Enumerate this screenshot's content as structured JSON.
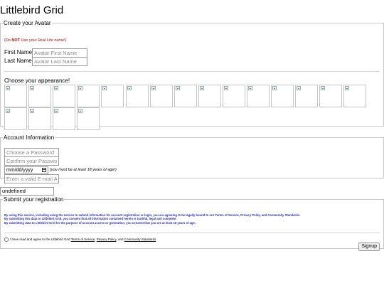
{
  "site": {
    "title": "Littlebird Grid"
  },
  "avatar": {
    "legend": "Create your Avatar",
    "warning_prefix": "(Do ",
    "warning_bold": "NOT",
    "warning_suffix": " Use your Real Life name!)",
    "first_name_label": "First Name:",
    "first_name_placeholder": "Avatar First Name",
    "last_name_label": "Last Name:",
    "last_name_placeholder": "Avatar Last Name",
    "appearance_label": "Choose your appearance!",
    "appearance_count": 19
  },
  "account": {
    "legend": "Account Information",
    "password_placeholder": "Choose a Password",
    "confirm_placeholder": "Confirm your Password",
    "birthdate_placeholder": "mm/dd/yyyy",
    "age_note": "(you must be at least 18 years of age!)",
    "email_placeholder": "Enter a valid E-mail Address"
  },
  "misc": {
    "undefined_value": "undefined"
  },
  "submit": {
    "legend": "Submit your registration",
    "legal_lines": [
      "By using this service, including using the service to submit information for account registration or login, you are agreeing to be legally bound to our Terms of Service, Privacy Policy and Community Standards.",
      "By submitting this data to Littlebird Grid, you consent that all information contained herein is truthful, legal and complete.",
      "By submitting data to Littlebird Grid for the purpose of account access or generation, you consent that you are at least 18 years of age."
    ],
    "agree_text": "I have read and agree to the Littlebird Grid",
    "tos_link": "Terms of Service",
    "privacy_link": "Privacy Policy",
    "and_text": "and",
    "community_link": "Community Standards",
    "signup_label": "Signup"
  }
}
